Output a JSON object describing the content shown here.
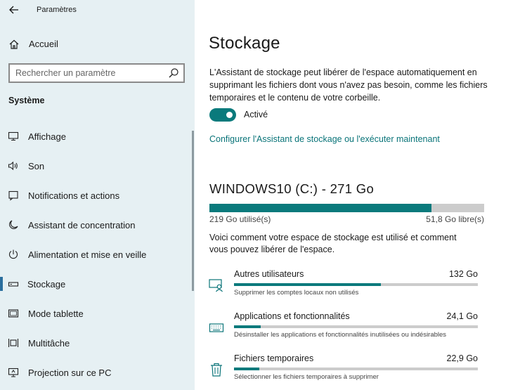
{
  "window": {
    "title": "Paramètres",
    "back_icon": "arrow-left-icon"
  },
  "sidebar": {
    "home": {
      "label": "Accueil",
      "icon": "home-icon"
    },
    "search": {
      "placeholder": "Rechercher un paramètre",
      "icon": "search-icon"
    },
    "section_title": "Système",
    "items": [
      {
        "label": "Affichage",
        "icon": "monitor-icon",
        "active": false
      },
      {
        "label": "Son",
        "icon": "speaker-icon",
        "active": false
      },
      {
        "label": "Notifications et actions",
        "icon": "notification-icon",
        "active": false
      },
      {
        "label": "Assistant de concentration",
        "icon": "moon-icon",
        "active": false
      },
      {
        "label": "Alimentation et mise en veille",
        "icon": "power-icon",
        "active": false
      },
      {
        "label": "Stockage",
        "icon": "drive-icon",
        "active": true
      },
      {
        "label": "Mode tablette",
        "icon": "tablet-icon",
        "active": false
      },
      {
        "label": "Multitâche",
        "icon": "multitask-icon",
        "active": false
      },
      {
        "label": "Projection sur ce PC",
        "icon": "projection-icon",
        "active": false
      }
    ]
  },
  "main": {
    "title": "Stockage",
    "description": "L'Assistant de stockage peut libérer de l'espace automatiquement en supprimant les fichiers dont vous n'avez pas besoin, comme les fichiers temporaires et le contenu de votre corbeille.",
    "toggle": {
      "state": "on",
      "label": "Activé"
    },
    "config_link": "Configurer l'Assistant de stockage ou l'exécuter maintenant",
    "drive": {
      "title": "WINDOWS10 (C:) - 271 Go",
      "used_label": "219 Go utilisé(s)",
      "free_label": "51,8 Go libre(s)",
      "used_fraction": 0.808
    },
    "intro": "Voici comment votre espace de stockage est utilisé et comment vous pouvez libérer de l'espace.",
    "categories": [
      {
        "name": "Autres utilisateurs",
        "size": "132 Go",
        "hint": "Supprimer les comptes locaux non utilisés",
        "fraction": 0.603,
        "icon": "users-icon"
      },
      {
        "name": "Applications et fonctionnalités",
        "size": "24,1 Go",
        "hint": "Désinstaller les applications et fonctionnalités inutilisées ou indésirables",
        "fraction": 0.11,
        "icon": "keyboard-icon"
      },
      {
        "name": "Fichiers temporaires",
        "size": "22,9 Go",
        "hint": "Sélectionner les fichiers temporaires à supprimer",
        "fraction": 0.105,
        "icon": "trash-icon"
      }
    ]
  },
  "colors": {
    "accent": "#0a7a7c",
    "link": "#0a7479",
    "sidebar_bg": "#e6f0f3",
    "track": "#cccccc"
  }
}
